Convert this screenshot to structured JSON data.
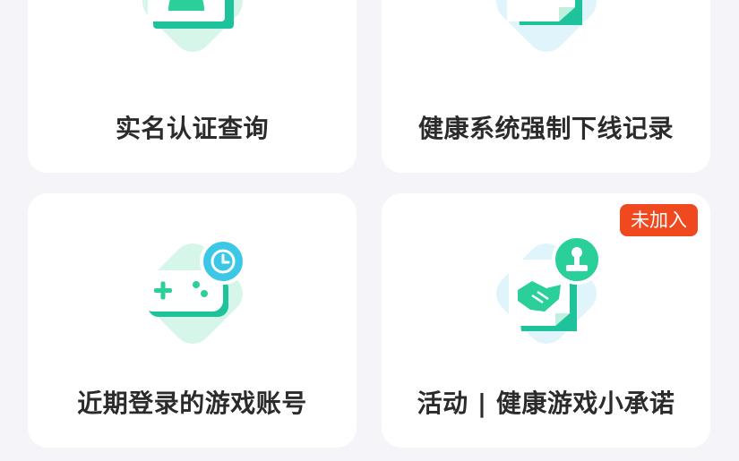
{
  "cards": [
    {
      "label": "实名认证查询",
      "icon": "id-card-icon",
      "accent": "#2bcf9a"
    },
    {
      "label": "健康系统强制下线记录",
      "icon": "document-record-icon",
      "accent": "#2bcf9a"
    },
    {
      "label": "近期登录的游戏账号",
      "icon": "gamepad-clock-icon",
      "accent": "#2bcf9a"
    },
    {
      "label": "活动 | 健康游戏小承诺",
      "icon": "handshake-stamp-icon",
      "accent": "#2bcf9a",
      "badge": "未加入"
    }
  ],
  "colors": {
    "background": "#f5f4f8",
    "card": "#ffffff",
    "badge": "#f0481f",
    "green": "#2bcf9a",
    "cyan": "#3cc7e6"
  }
}
